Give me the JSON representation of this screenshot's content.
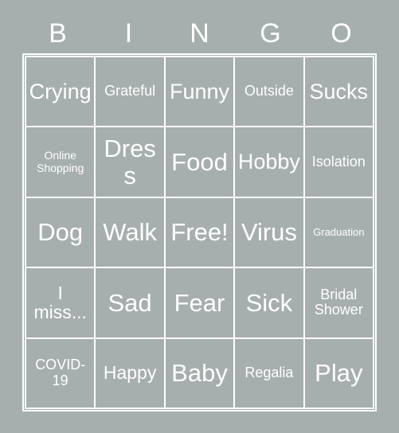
{
  "card": {
    "title": "BINGO",
    "header_letters": [
      "B",
      "I",
      "N",
      "G",
      "O"
    ],
    "colors": {
      "background": "#a7aeae",
      "border": "#ffffff",
      "text": "#ffffff"
    },
    "grid_size": "5x5",
    "free_space": "Free!",
    "cells": [
      {
        "text": "Crying",
        "size": "fs-lg"
      },
      {
        "text": "Grateful",
        "size": "fs-sm"
      },
      {
        "text": "Funny",
        "size": "fs-lg"
      },
      {
        "text": "Outside",
        "size": "fs-sm"
      },
      {
        "text": "Sucks",
        "size": "fs-lg"
      },
      {
        "text": "Online\nShopping",
        "size": "fs-xs"
      },
      {
        "text": "Dress",
        "size": "fs-xl"
      },
      {
        "text": "Food",
        "size": "fs-xl"
      },
      {
        "text": "Hobby",
        "size": "fs-lg"
      },
      {
        "text": "Isolation",
        "size": "fs-sm"
      },
      {
        "text": "Dog",
        "size": "fs-xl"
      },
      {
        "text": "Walk",
        "size": "fs-xl"
      },
      {
        "text": "Free!",
        "size": "fs-xl"
      },
      {
        "text": "Virus",
        "size": "fs-xl"
      },
      {
        "text": "Graduation",
        "size": "fs-xxs"
      },
      {
        "text": "I\nmiss...",
        "size": "fs-md"
      },
      {
        "text": "Sad",
        "size": "fs-xl"
      },
      {
        "text": "Fear",
        "size": "fs-xl"
      },
      {
        "text": "Sick",
        "size": "fs-xl"
      },
      {
        "text": "Bridal\nShower",
        "size": "fs-sm"
      },
      {
        "text": "COVID-\n19",
        "size": "fs-sm"
      },
      {
        "text": "Happy",
        "size": "fs-md"
      },
      {
        "text": "Baby",
        "size": "fs-xl"
      },
      {
        "text": "Regalia",
        "size": "fs-sm"
      },
      {
        "text": "Play",
        "size": "fs-xl"
      }
    ]
  }
}
